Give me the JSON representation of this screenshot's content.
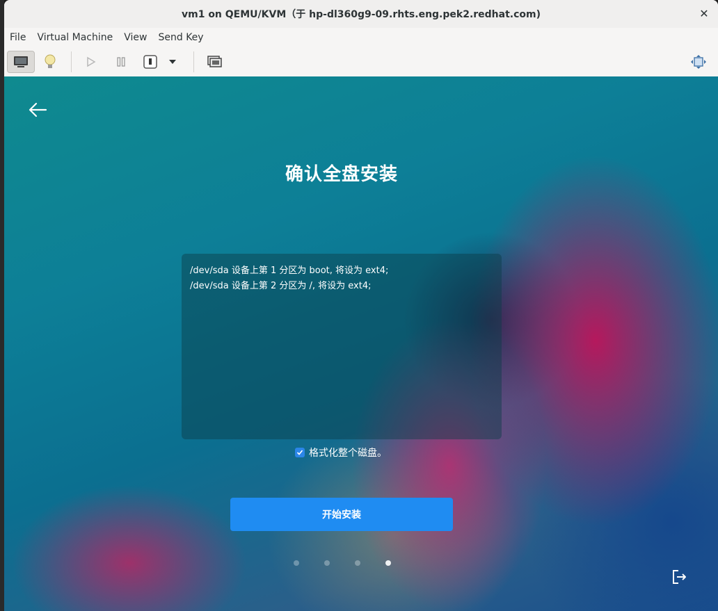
{
  "window": {
    "title": "vm1 on QEMU/KVM（于 hp-dl360g9-09.rhts.eng.pek2.redhat.com)",
    "close_glyph": "✕"
  },
  "menubar": {
    "items": [
      "File",
      "Virtual Machine",
      "View",
      "Send Key"
    ]
  },
  "toolbar": {
    "buttons": [
      {
        "icon": "monitor-icon",
        "active": true
      },
      {
        "icon": "lightbulb-icon",
        "active": false
      },
      {
        "icon": "play-icon",
        "active": false
      },
      {
        "icon": "pause-icon",
        "active": false
      },
      {
        "icon": "power-icon",
        "active": false
      },
      {
        "icon": "dropdown-arrow-icon",
        "active": false
      },
      {
        "icon": "screenshot-icon",
        "active": false
      },
      {
        "icon": "fullscreen-icon",
        "active": false
      }
    ]
  },
  "installer": {
    "title": "确认全盘安装",
    "partition_lines": [
      "/dev/sda 设备上第 1 分区为 boot, 将设为 ext4;",
      "/dev/sda 设备上第 2 分区为 /, 将设为 ext4;"
    ],
    "format_checkbox": {
      "label": "格式化整个磁盘。",
      "checked": true
    },
    "start_button": "开始安装",
    "page_dots": {
      "count": 4,
      "current": 4
    }
  },
  "colors": {
    "accent": "#1f8cf2",
    "checkbox": "#2b86e8",
    "text_light": "#ffffff"
  }
}
